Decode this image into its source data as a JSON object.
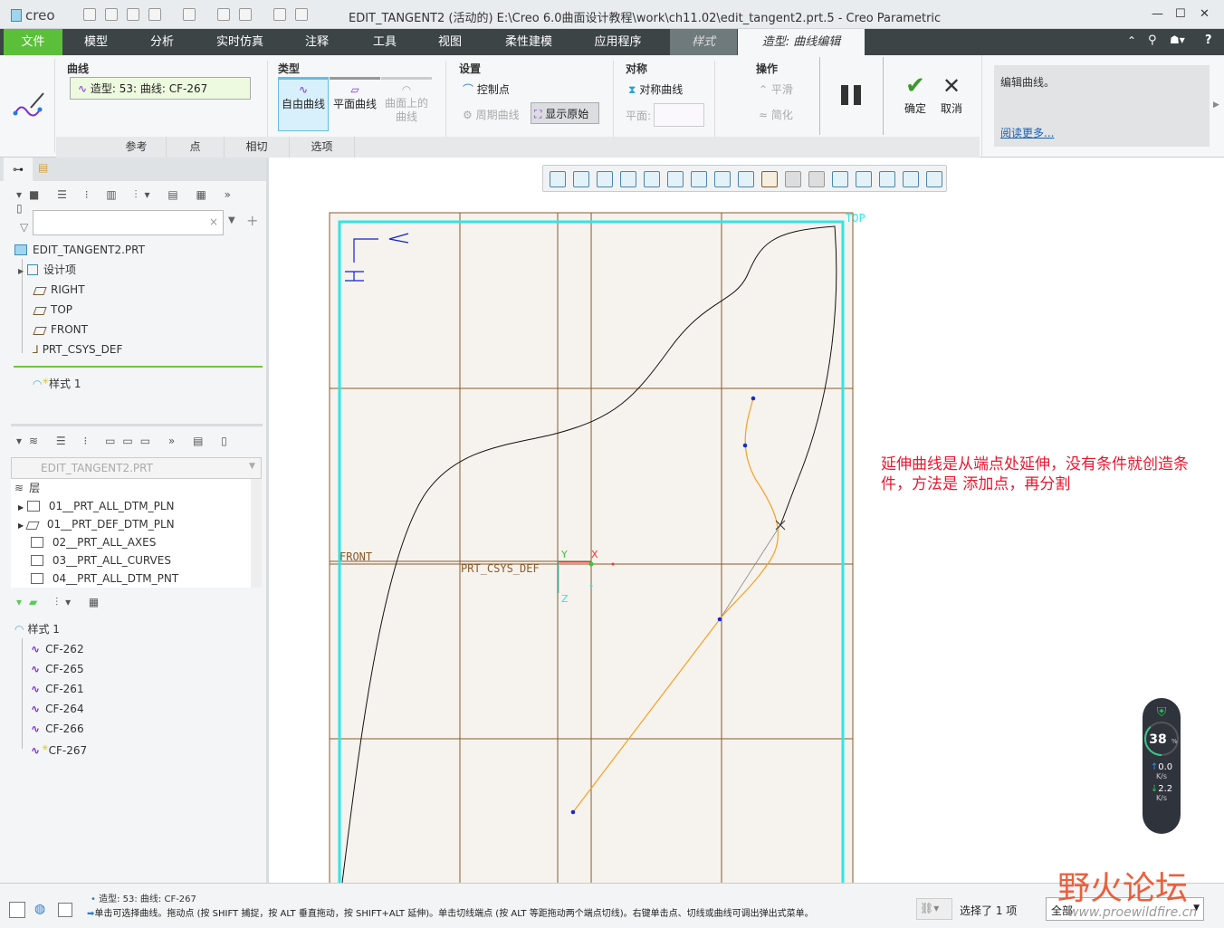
{
  "app": {
    "logo": "creo",
    "title": "EDIT_TANGENT2 (活动的) E:\\Creo 6.0曲面设计教程\\work\\ch11.02\\edit_tangent2.prt.5 - Creo Parametric"
  },
  "menu": [
    "文件",
    "模型",
    "分析",
    "实时仿真",
    "注释",
    "工具",
    "视图",
    "柔性建模",
    "应用程序",
    "样式",
    "造型: 曲线编辑"
  ],
  "ribbon": {
    "curve_group": "曲线",
    "curve_value": "造型: 53: 曲线: CF-267",
    "type_group": "类型",
    "type_free": "自由曲线",
    "type_plane": "平面曲线",
    "type_surface": "曲面上的曲线",
    "settings_group": "设置",
    "control_points": "控制点",
    "periodic": "周期曲线",
    "show_original": "显示原始",
    "symmetry_group": "对称",
    "symmetric_curve": "对称曲线",
    "plane_label": "平面:",
    "ops_group": "操作",
    "smooth": "平滑",
    "simplify": "简化",
    "ok": "确定",
    "cancel": "取消",
    "help_text": "编辑曲线。",
    "read_more": "阅读更多...",
    "subtabs": [
      "参考",
      "点",
      "相切",
      "选项"
    ]
  },
  "model_tree": {
    "root": "EDIT_TANGENT2.PRT",
    "items": [
      "设计项",
      "RIGHT",
      "TOP",
      "FRONT",
      "PRT_CSYS_DEF"
    ],
    "after_insert": "样式 1"
  },
  "layers": {
    "model": "EDIT_TANGENT2.PRT",
    "header": "层",
    "items": [
      "01__PRT_ALL_DTM_PLN",
      "01__PRT_DEF_DTM_PLN",
      "02__PRT_ALL_AXES",
      "03__PRT_ALL_CURVES",
      "04__PRT_ALL_DTM_PNT"
    ]
  },
  "style_tree": {
    "root": "样式 1",
    "items": [
      "CF-262",
      "CF-265",
      "CF-261",
      "CF-264",
      "CF-266",
      "CF-267"
    ]
  },
  "graphics": {
    "top_label": "TOP",
    "front_label": "FRONT",
    "csys_label": "PRT_CSYS_DEF",
    "axis_x": "X",
    "axis_y": "Y",
    "axis_z": "Z",
    "annotation": "延伸曲线是从端点处延伸，没有条件就创造条件，方法是 添加点，再分割"
  },
  "net_widget": {
    "percent": "38",
    "unit": "%",
    "up": "0.0",
    "down": "2.2",
    "rate_unit": "K/s",
    "level": 0.38
  },
  "status": {
    "line1": "造型: 53: 曲线: CF-267",
    "line2": "单击可选择曲线。拖动点 (按 SHIFT 捕捉，按 ALT 垂直拖动，按 SHIFT+ALT 延伸)。单击切线端点 (按 ALT 等距拖动两个端点切线)。右键单击点、切线或曲线可调出弹出式菜单。",
    "selected": "选择了 1 项",
    "filter": "全部"
  },
  "watermark": {
    "text": "野火论坛",
    "url": "www.proewildfire.cn"
  },
  "colors": {
    "menubar": "#3c4446",
    "file_tab": "#5cbf3a",
    "accent_cyan": "#2ee6e6",
    "datum": "#8b5a2b",
    "annotation": "#e8182e"
  }
}
